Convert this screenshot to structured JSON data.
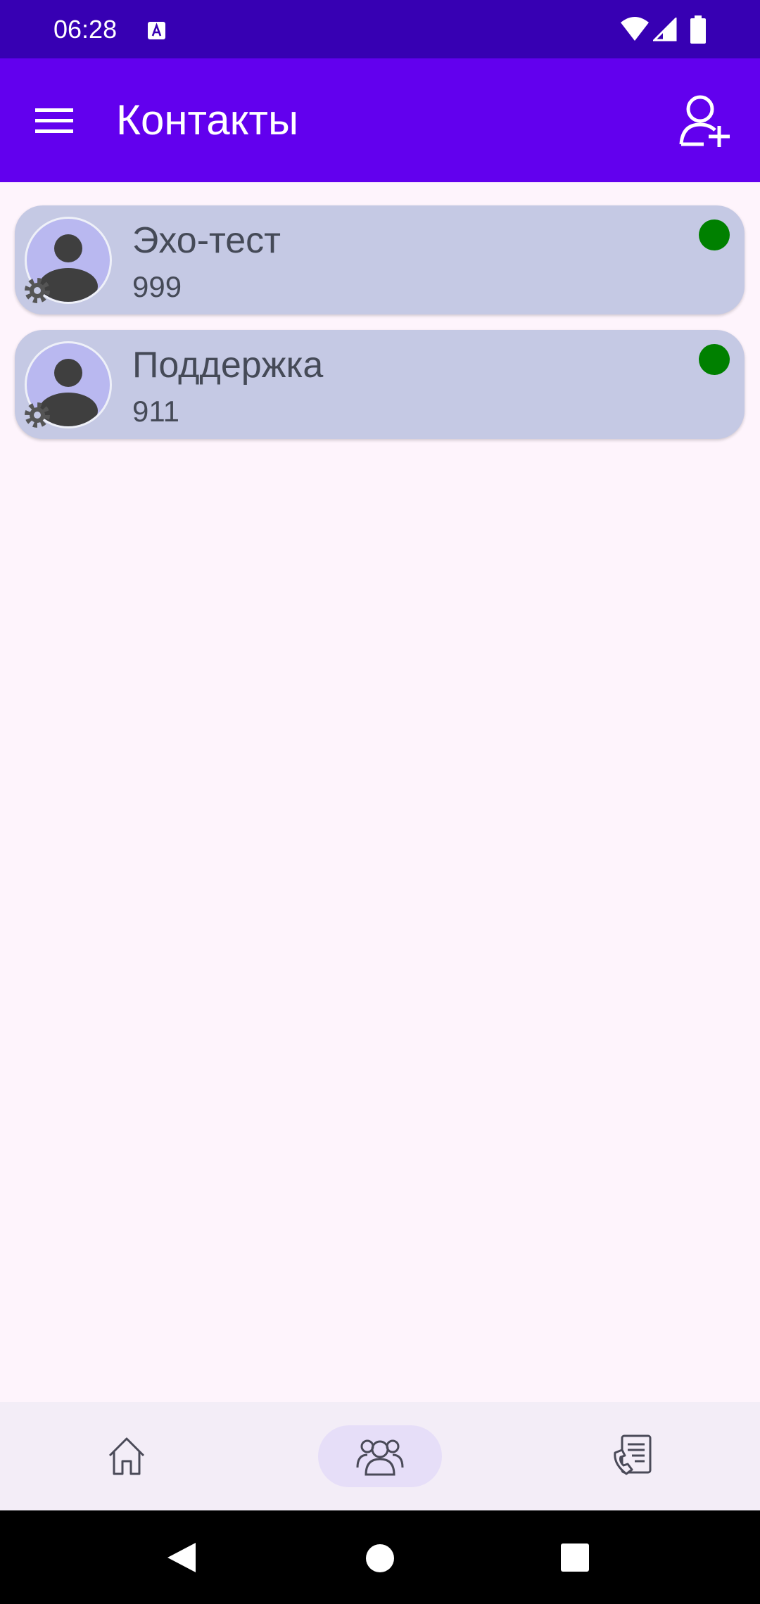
{
  "status_bar": {
    "time": "06:28",
    "icons": [
      "keyboard-a-icon",
      "wifi-icon",
      "cellular-signal-icon",
      "battery-icon"
    ]
  },
  "app_bar": {
    "title": "Контакты",
    "menu_icon": "hamburger-menu-icon",
    "action_icon": "add-contact-icon"
  },
  "contacts": [
    {
      "name": "Эхо-тест",
      "number": "999",
      "status": "online",
      "status_color": "#008000"
    },
    {
      "name": "Поддержка",
      "number": "911",
      "status": "online",
      "status_color": "#008000"
    }
  ],
  "bottom_nav": {
    "items": [
      {
        "icon": "home-icon",
        "selected": false
      },
      {
        "icon": "contacts-group-icon",
        "selected": true
      },
      {
        "icon": "call-history-icon",
        "selected": false
      }
    ]
  },
  "system_nav": {
    "buttons": [
      "back-icon",
      "home-circle-icon",
      "recents-icon"
    ]
  },
  "colors": {
    "status_bar": "#3700b3",
    "app_bar": "#6200ee",
    "background": "#fef4fc",
    "card": "#c5c9e4",
    "online": "#008000"
  }
}
